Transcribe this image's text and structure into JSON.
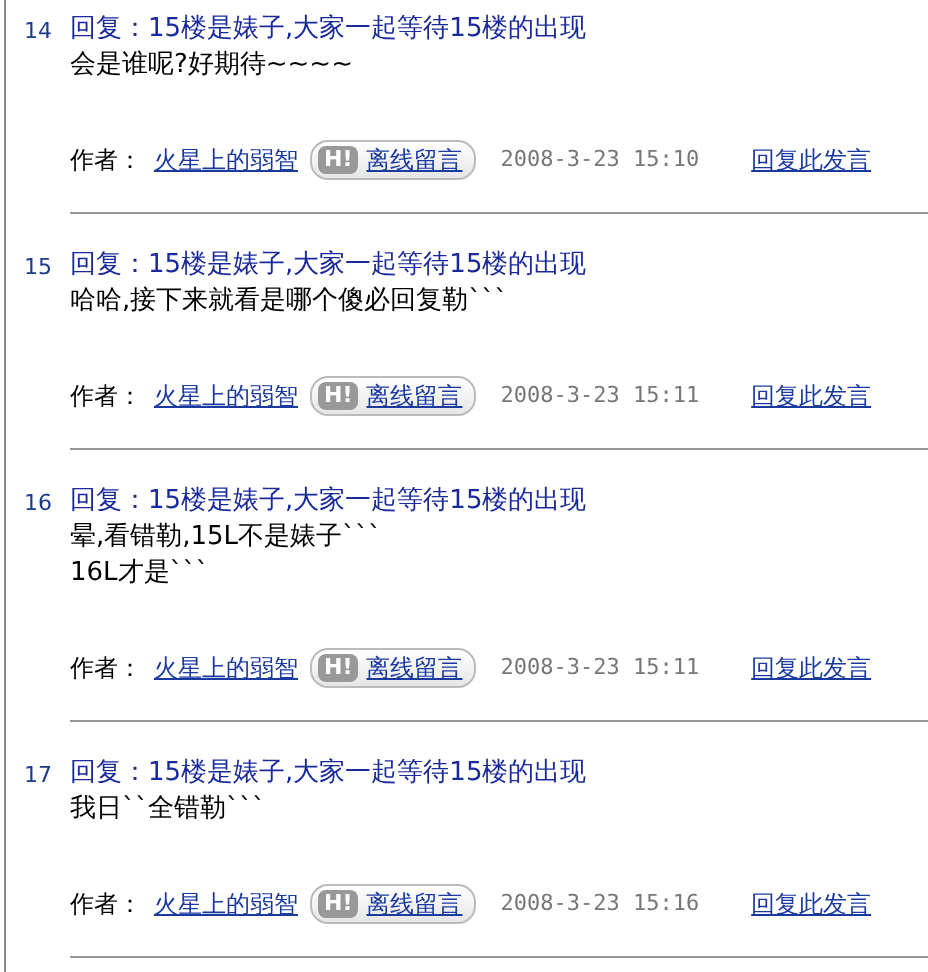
{
  "posts": [
    {
      "number": "14",
      "title": "回复：15楼是婊子,大家一起等待15楼的出现",
      "body": [
        "会是谁呢?好期待~~~~"
      ],
      "author_label": "作者：",
      "author": "火星上的弱智",
      "hi": "H!",
      "offline": "离线留言",
      "date": "2008-3-23 15:10",
      "reply": "回复此发言"
    },
    {
      "number": "15",
      "title": "回复：15楼是婊子,大家一起等待15楼的出现",
      "body": [
        "哈哈,接下来就看是哪个傻必回复勒```"
      ],
      "author_label": "作者：",
      "author": "火星上的弱智",
      "hi": "H!",
      "offline": "离线留言",
      "date": "2008-3-23 15:11",
      "reply": "回复此发言"
    },
    {
      "number": "16",
      "title": "回复：15楼是婊子,大家一起等待15楼的出现",
      "body": [
        "晕,看错勒,15L不是婊子```",
        "16L才是```"
      ],
      "author_label": "作者：",
      "author": "火星上的弱智",
      "hi": "H!",
      "offline": "离线留言",
      "date": "2008-3-23 15:11",
      "reply": "回复此发言"
    },
    {
      "number": "17",
      "title": "回复：15楼是婊子,大家一起等待15楼的出现",
      "body": [
        "我日``全错勒```"
      ],
      "author_label": "作者：",
      "author": "火星上的弱智",
      "hi": "H!",
      "offline": "离线留言",
      "date": "2008-3-23 15:16",
      "reply": "回复此发言"
    }
  ]
}
